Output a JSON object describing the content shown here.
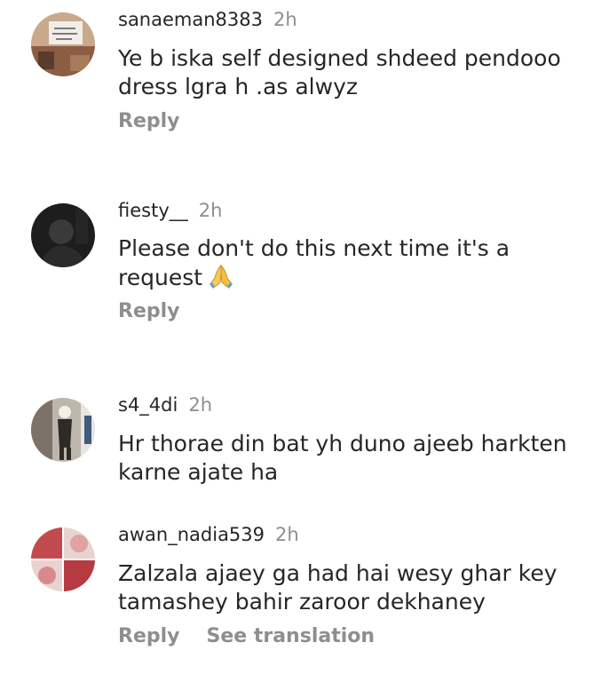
{
  "comments": [
    {
      "username": "sanaeman8383",
      "time": "2h",
      "text": "Ye b iska self designed shdeed pendooo dress lgra h .as alwyz",
      "reply": "Reply",
      "translate": ""
    },
    {
      "username": "fiesty__",
      "time": "2h",
      "text": "Please don't do this next time it's a request",
      "emoji": "folded-hands",
      "reply": "Reply",
      "translate": ""
    },
    {
      "username": "s4_4di",
      "time": "2h",
      "text": "Hr thorae din bat yh duno ajeeb harkten karne ajate ha",
      "reply": "",
      "translate": ""
    },
    {
      "username": "awan_nadia539",
      "time": "2h",
      "text": "Zalzala ajaey ga had hai wesy ghar key tamashey bahir zaroor dekhaney",
      "reply": "Reply",
      "translate": "See translation"
    }
  ]
}
